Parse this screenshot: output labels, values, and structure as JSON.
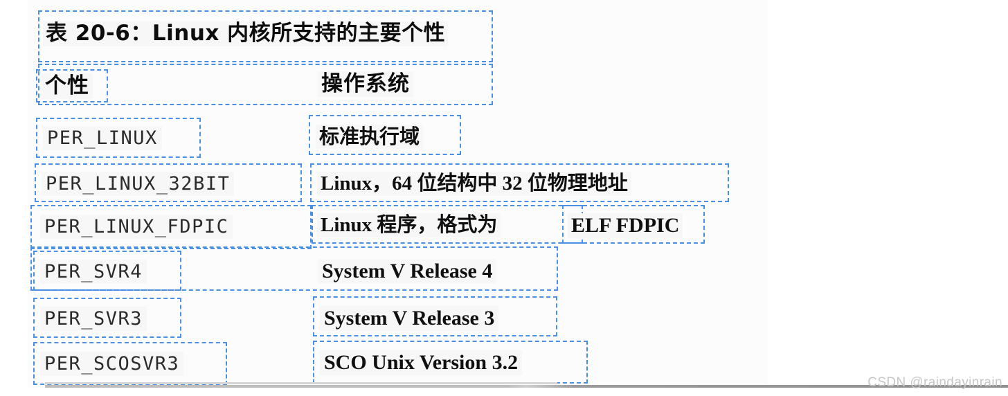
{
  "document": {
    "type": "scanned-table",
    "caption": "表 20-6：Linux 内核所支持的主要个性",
    "watermark": "CSDN @raindayinrain",
    "ghost_text": "",
    "colors": {
      "detection_box": "#4a90e2",
      "text": "#101010",
      "paper": "#fcfcfc",
      "watermark": "#c6c6c6"
    }
  },
  "table": {
    "headers": {
      "col1": "个性",
      "col2": "操作系统"
    },
    "rows": [
      {
        "personality": "PER_LINUX",
        "os": "标准执行域"
      },
      {
        "personality": "PER_LINUX_32BIT",
        "os": "Linux，64 位结构中 32 位物理地址"
      },
      {
        "personality": "PER_LINUX_FDPIC",
        "os_cjk": "Linux 程序，格式为",
        "os_latin": "ELF FDPIC"
      },
      {
        "personality": "PER_SVR4",
        "os": "System V Release 4"
      },
      {
        "personality": "PER_SVR3",
        "os": "System V Release 3"
      },
      {
        "personality": "PER_SCOSVR3",
        "os": "SCO Unix Version 3.2"
      }
    ]
  }
}
